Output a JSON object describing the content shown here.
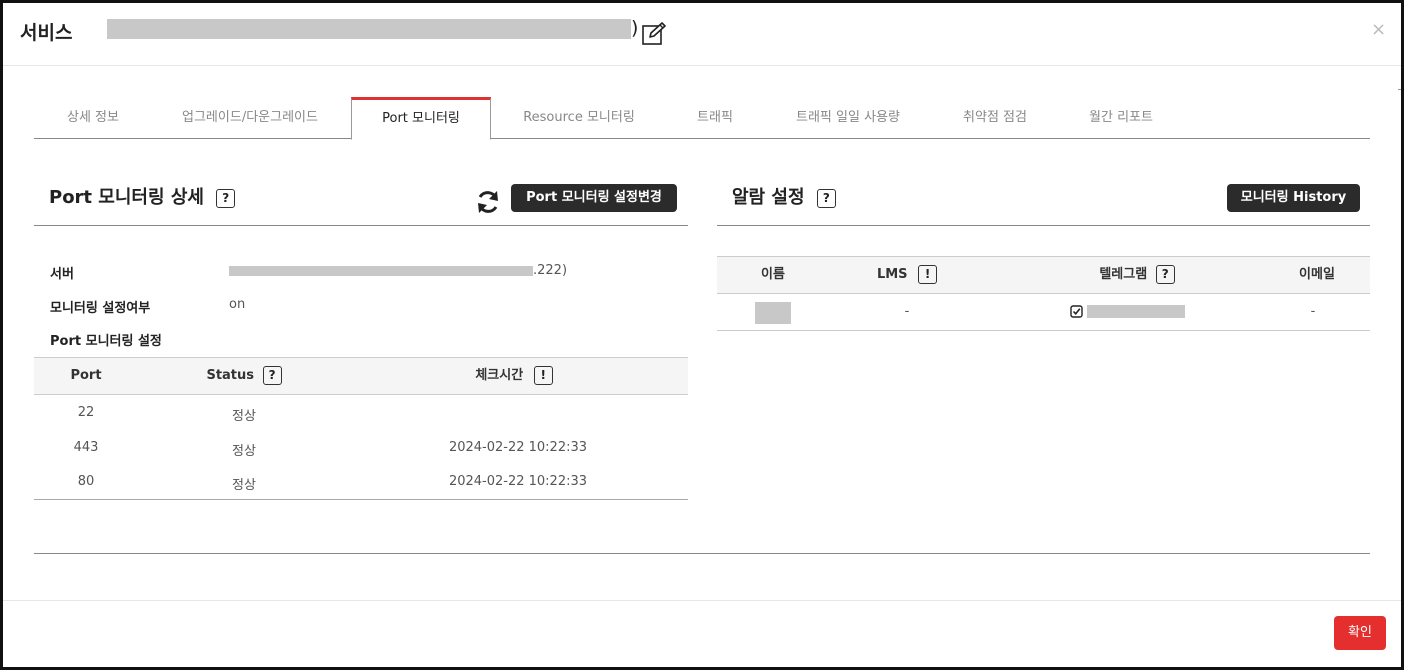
{
  "header": {
    "title": "서비스",
    "title_suffix": ")",
    "close_label": "×"
  },
  "tabs": [
    {
      "label": "상세 정보"
    },
    {
      "label": "업그레이드/다운그레이드"
    },
    {
      "label": "Port 모니터링"
    },
    {
      "label": "Resource 모니터링"
    },
    {
      "label": "트래픽"
    },
    {
      "label": "트래픽 일일 사용량"
    },
    {
      "label": "취약점 점검"
    },
    {
      "label": "월간 리포트"
    }
  ],
  "port_panel": {
    "title": "Port 모니터링 상세",
    "help": "?",
    "change_settings_button": "Port 모니터링 설정변경",
    "server_label": "서버",
    "server_value_suffix": ".222)",
    "monitoring_enabled_label": "모니터링 설정여부",
    "monitoring_enabled_value": "on",
    "port_settings_label": "Port 모니터링 설정",
    "table": {
      "columns": [
        "Port",
        "Status",
        "체크시간"
      ],
      "status_help": "?",
      "checktime_info": "!",
      "rows": [
        {
          "port": "22",
          "status": "정상",
          "check_time": ""
        },
        {
          "port": "443",
          "status": "정상",
          "check_time": "2024-02-22 10:22:33"
        },
        {
          "port": "80",
          "status": "정상",
          "check_time": "2024-02-22 10:22:33"
        }
      ]
    }
  },
  "alarm_panel": {
    "title": "알람 설정",
    "help": "?",
    "history_button": "모니터링 History",
    "table": {
      "columns": [
        "이름",
        "LMS",
        "텔레그램",
        "이메일"
      ],
      "lms_info": "!",
      "telegram_help": "?",
      "rows": [
        {
          "lms": "-",
          "email": "-"
        }
      ]
    }
  },
  "footer": {
    "ok_button": "확인"
  }
}
